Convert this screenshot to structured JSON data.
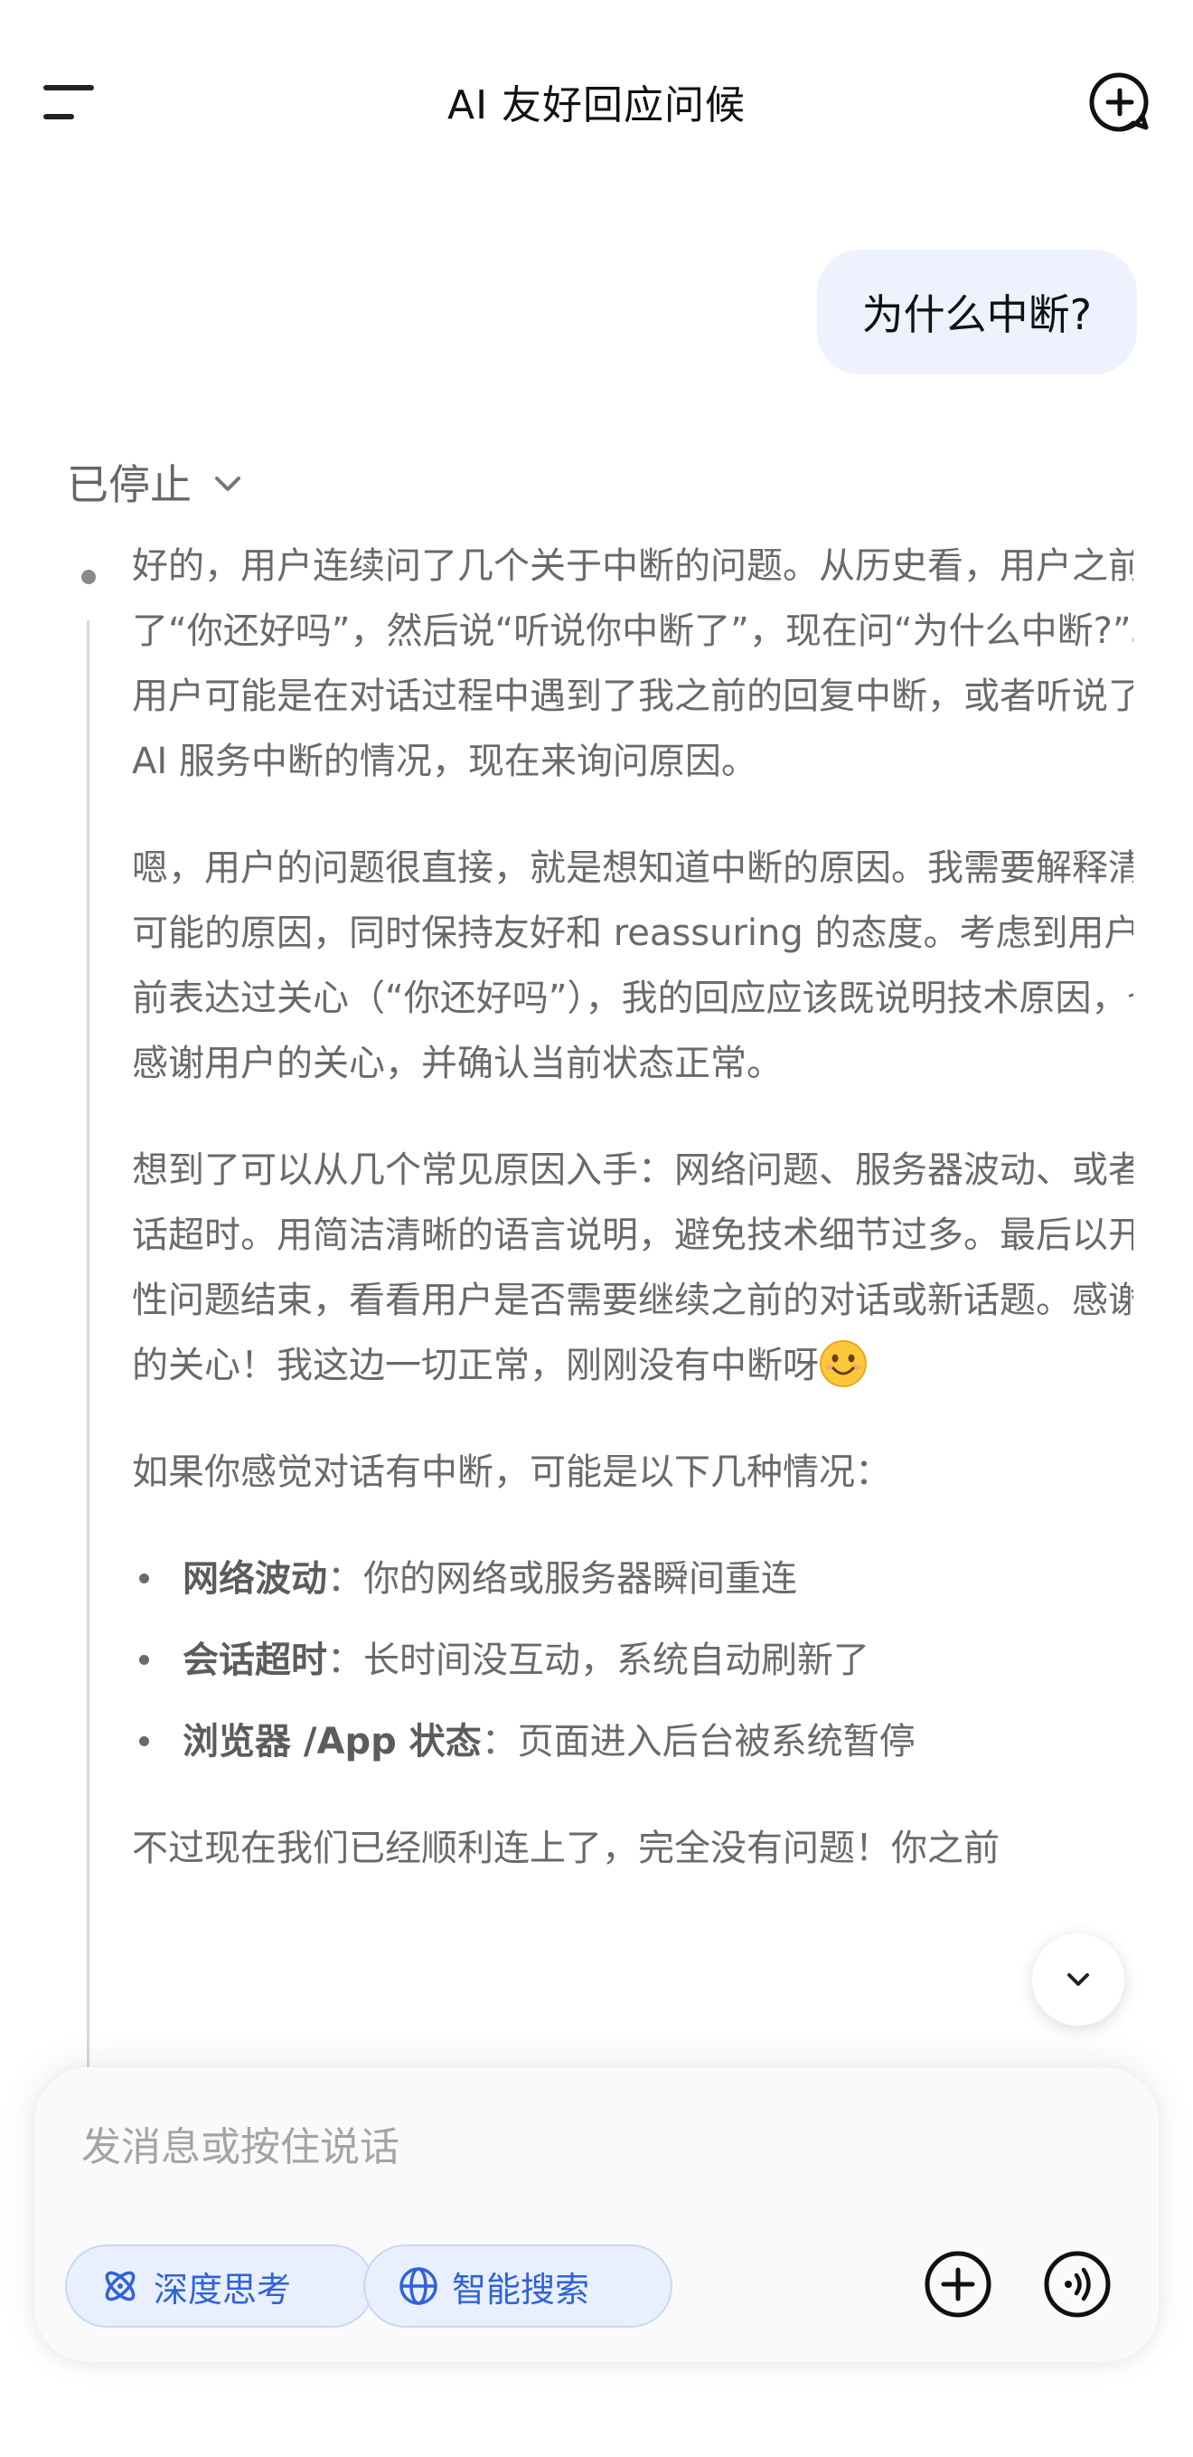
{
  "header": {
    "title": "AI 友好回应问候"
  },
  "conversation": {
    "user_message": "为什么中断?",
    "status_label": "已停止",
    "thinking": {
      "paragraphs": [
        "好的，用户连续问了几个关于中断的问题。从历史看，用户之前问了“你还好吗”，然后说“听说你中断了”，现在问“为什么中断?”。用户可能是在对话过程中遇到了我之前的回复中断，或者听说了 AI 服务中断的情况，现在来询问原因。",
        "嗯，用户的问题很直接，就是想知道中断的原因。我需要解释清楚可能的原因，同时保持友好和 reassuring 的态度。考虑到用户之前表达过关心（“你还好吗”），我的回应应该既说明技术原因，也感谢用户的关心，并确认当前状态正常。",
        "想到了可以从几个常见原因入手：网络问题、服务器波动、或者会话超时。用简洁清晰的语言说明，避免技术细节过多。最后以开放性问题结束，看看用户是否需要继续之前的对话或新话题。感谢你的关心！我这边一切正常，刚刚没有中断呀",
        "如果你感觉对话有中断，可能是以下几种情况："
      ],
      "list": [
        {
          "term": "网络波动",
          "desc": "：你的网络或服务器瞬间重连"
        },
        {
          "term": "会话超时",
          "desc": "：长时间没互动，系统自动刷新了"
        },
        {
          "term": "浏览器 /App 状态",
          "desc": "：页面进入后台被系统暂停"
        }
      ],
      "trailing": "不过现在我们已经顺利连上了，完全没有问题！你之前"
    }
  },
  "composer": {
    "placeholder": "发消息或按住说话",
    "deep_think_label": "深度思考",
    "web_search_label": "智能搜索"
  },
  "colors": {
    "accent": "#2f63d8",
    "chip_bg": "#e9effc",
    "user_bubble_bg": "#edf2fe"
  },
  "icons": {
    "menu": "menu-icon",
    "new_chat": "new-chat-icon",
    "status_chevron": "chevron-down-icon",
    "scroll_down": "chevron-down-icon",
    "deep_think": "atom-icon",
    "web_search": "globe-icon",
    "add": "plus-circle-icon",
    "voice": "voice-icon"
  }
}
